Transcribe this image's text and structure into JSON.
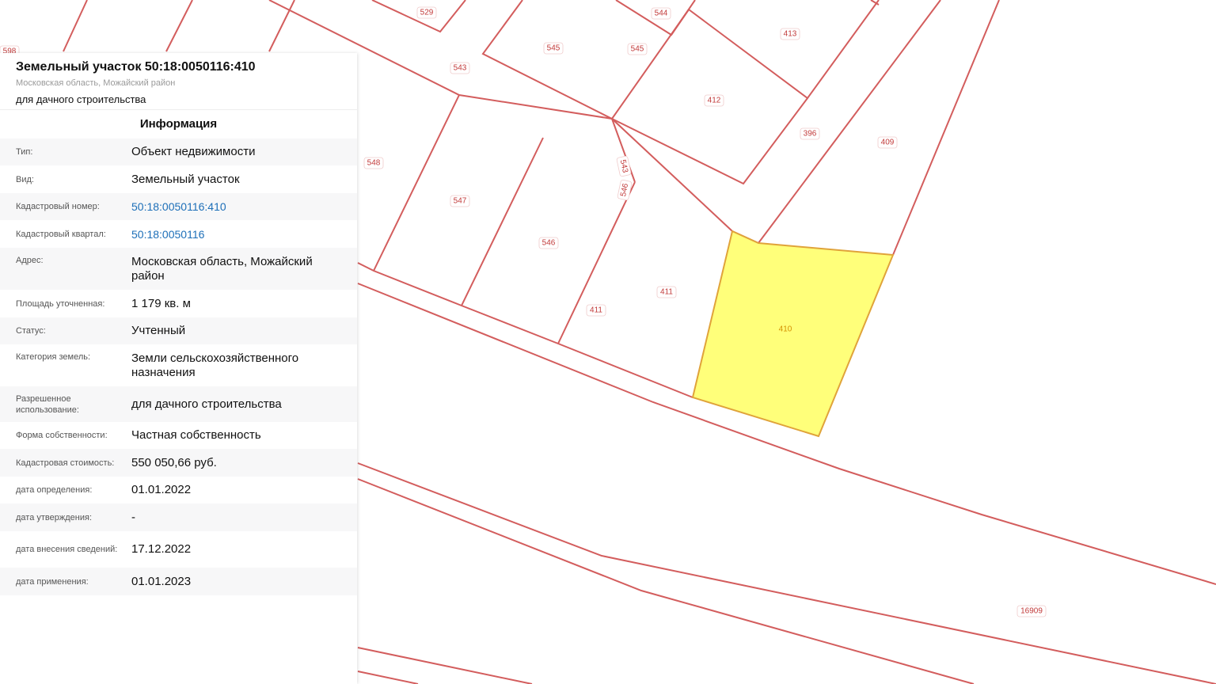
{
  "header": {
    "title": "Земельный участок 50:18:0050116:410",
    "region": "Московская область, Можайский район",
    "use": "для дачного строительства"
  },
  "info": {
    "section_title": "Информация",
    "rows": [
      {
        "label": "Тип:",
        "value": "Объект недвижимости"
      },
      {
        "label": "Вид:",
        "value": "Земельный участок"
      },
      {
        "label": "Кадастровый номер:",
        "value": "50:18:0050116:410"
      },
      {
        "label": "Кадастровый квартал:",
        "value": "50:18:0050116"
      },
      {
        "label": "Адрес:",
        "value": "Московская область, Можайский район"
      },
      {
        "label": "Площадь уточненная:",
        "value": "1 179 кв. м"
      },
      {
        "label": "Статус:",
        "value": "Учтенный"
      },
      {
        "label": "Категория земель:",
        "value": "Земли сельскохозяйственного назначения"
      },
      {
        "label": "Разрешенное использование:",
        "value": "для дачного строительства"
      },
      {
        "label": "Форма собственности:",
        "value": "Частная собственность"
      },
      {
        "label": "Кадастровая стоимость:",
        "value": "550 050,66 руб."
      },
      {
        "label": "дата определения:",
        "value": "01.01.2022"
      },
      {
        "label": "дата утверждения:",
        "value": "-"
      },
      {
        "label": "дата внесения сведений:",
        "value": "17.12.2022"
      },
      {
        "label": "дата применения:",
        "value": "01.01.2023"
      }
    ]
  },
  "map": {
    "parcel_labels": [
      "598",
      "529",
      "544",
      "413",
      "545",
      "545",
      "543",
      "412",
      "396",
      "409",
      "548",
      "543",
      "546",
      "547",
      "546",
      "411",
      "411",
      "410",
      "16909"
    ],
    "selected_label": "410",
    "colors": {
      "parcel_border": "#d35d5d",
      "selected_fill": "#ffff7a",
      "selected_border": "#e0a33a",
      "link": "#1d6fb8"
    }
  }
}
